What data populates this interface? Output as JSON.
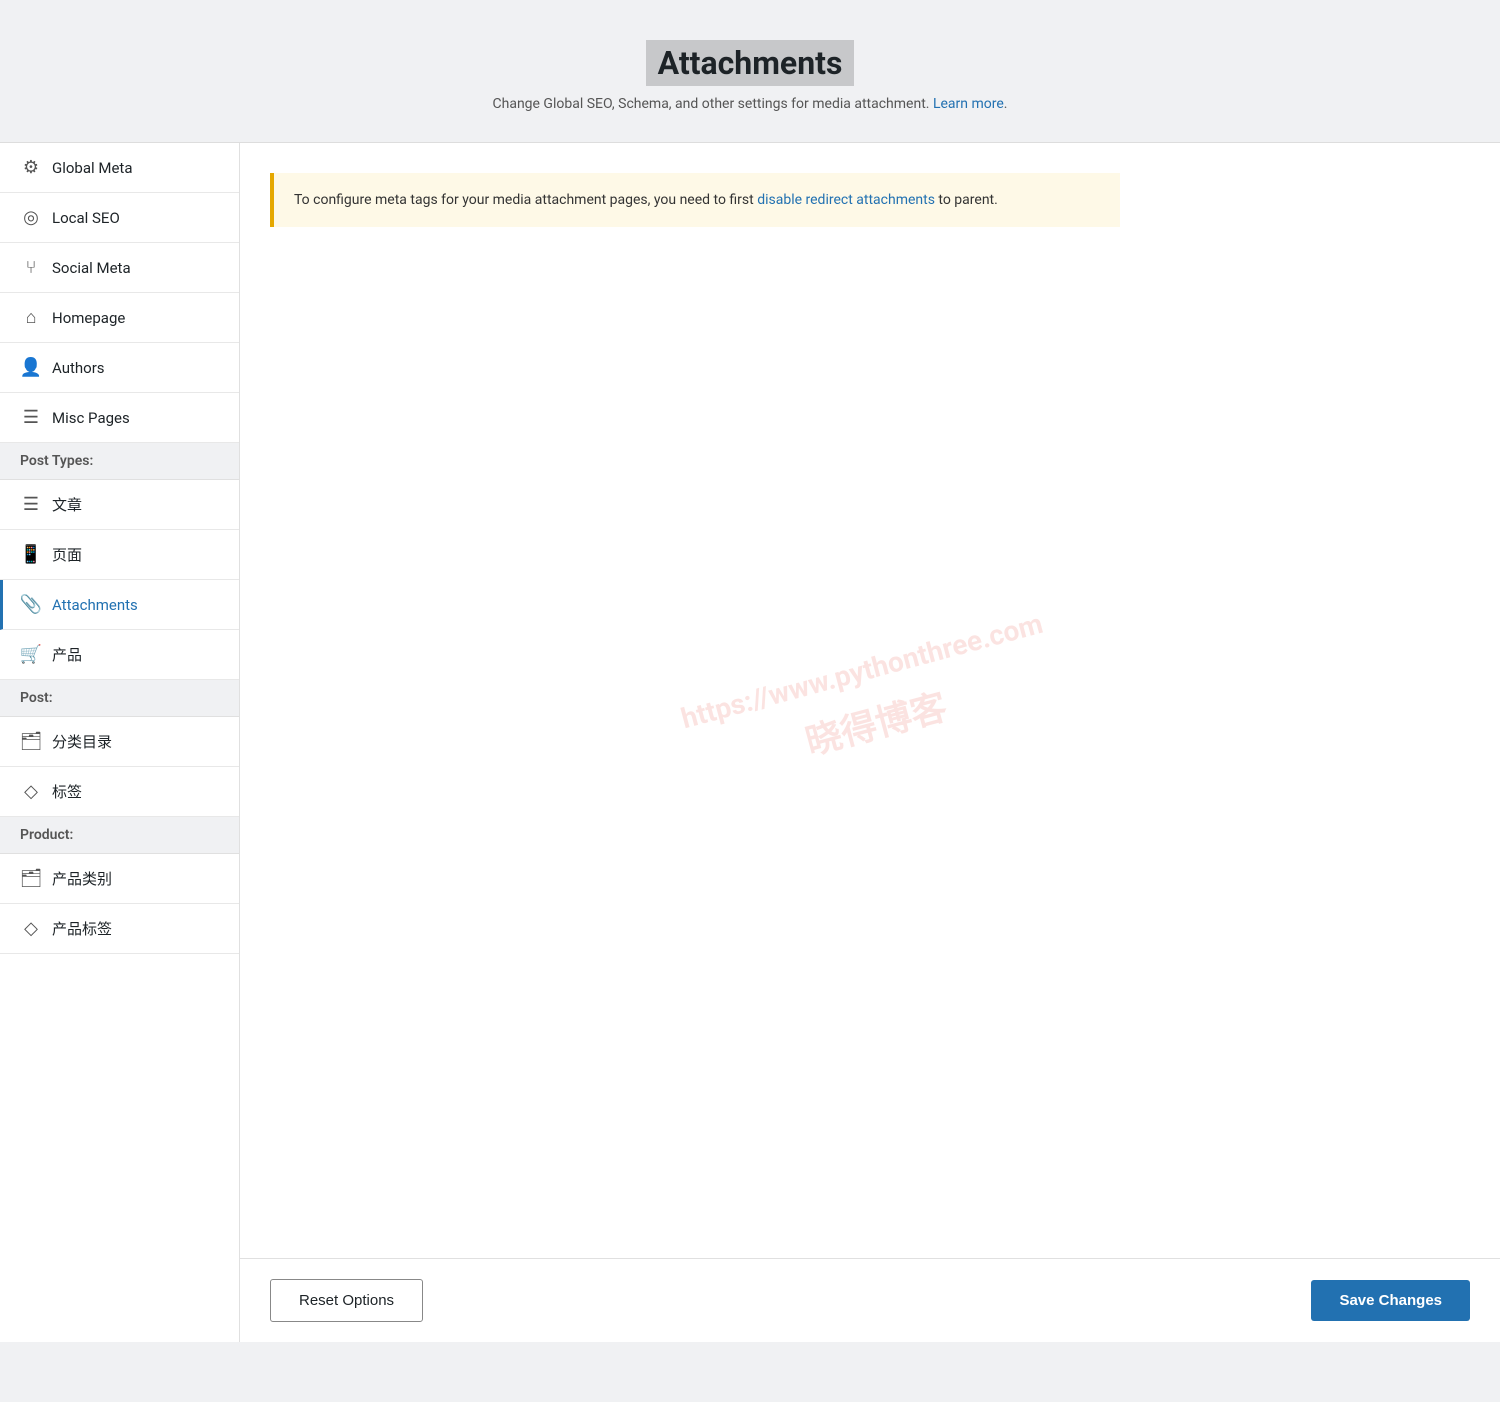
{
  "header": {
    "title": "Attachments",
    "description": "Change Global SEO, Schema, and other settings for media attachment.",
    "learn_more_label": "Learn more"
  },
  "notice": {
    "text_before_link": "To configure meta tags for your media attachment pages, you need to first ",
    "link_label": "disable redirect attachments",
    "text_after_link": " to parent."
  },
  "sidebar": {
    "items": [
      {
        "id": "global-meta",
        "label": "Global Meta",
        "icon": "⚙"
      },
      {
        "id": "local-seo",
        "label": "Local SEO",
        "icon": "📍"
      },
      {
        "id": "social-meta",
        "label": "Social Meta",
        "icon": "🔗"
      },
      {
        "id": "homepage",
        "label": "Homepage",
        "icon": "🏠"
      },
      {
        "id": "authors",
        "label": "Authors",
        "icon": "👥"
      },
      {
        "id": "misc-pages",
        "label": "Misc Pages",
        "icon": "≡"
      }
    ],
    "sections": [
      {
        "id": "post-types",
        "label": "Post Types:",
        "items": [
          {
            "id": "articles",
            "label": "文章",
            "icon": "📄"
          },
          {
            "id": "pages",
            "label": "页面",
            "icon": "📱"
          },
          {
            "id": "attachments",
            "label": "Attachments",
            "icon": "📎",
            "active": true
          }
        ]
      },
      {
        "id": "product",
        "label": "",
        "items": [
          {
            "id": "products",
            "label": "产品",
            "icon": "🛒"
          }
        ]
      },
      {
        "id": "post",
        "label": "Post:",
        "items": [
          {
            "id": "category",
            "label": "分类目录",
            "icon": "📁"
          },
          {
            "id": "tag",
            "label": "标签",
            "icon": "🏷"
          }
        ]
      },
      {
        "id": "product-tax",
        "label": "Product:",
        "items": [
          {
            "id": "product-category",
            "label": "产品类别",
            "icon": "📁"
          },
          {
            "id": "product-tag",
            "label": "产品标签",
            "icon": "🏷"
          }
        ]
      }
    ]
  },
  "watermark": {
    "url": "https://www.pythonthree.com",
    "name": "晓得博客"
  },
  "footer": {
    "reset_label": "Reset Options",
    "save_label": "Save Changes"
  }
}
